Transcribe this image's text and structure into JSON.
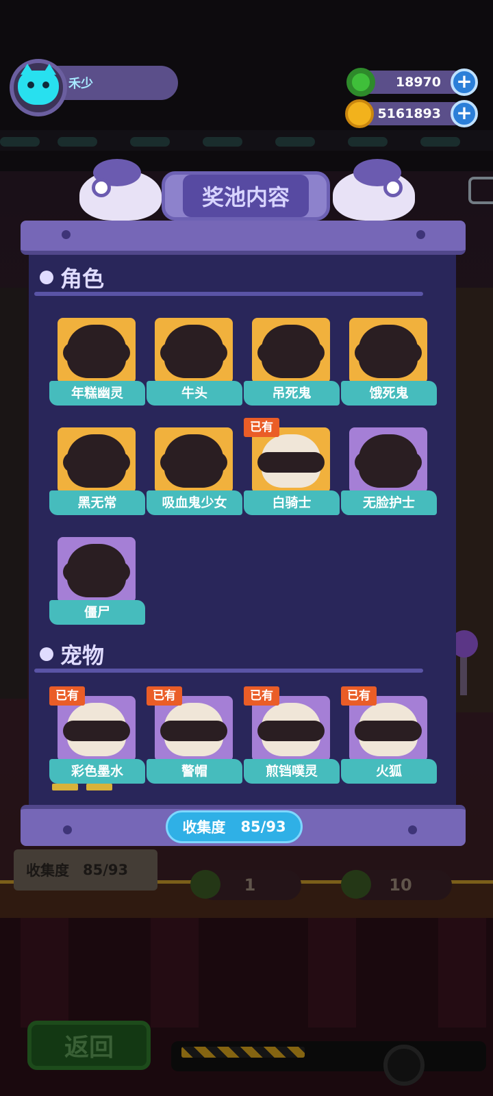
{
  "player": {
    "name": "禾少"
  },
  "currencies": [
    {
      "icon": "green-donut-icon",
      "value": "18970"
    },
    {
      "icon": "gold-planet-coin-icon",
      "value": "5161893"
    }
  ],
  "modal": {
    "title": "奖池内容",
    "sections": {
      "characters": {
        "title": "角色",
        "items": [
          {
            "name": "年糕幽灵",
            "owned": false,
            "rarity": "gold"
          },
          {
            "name": "牛头",
            "owned": false,
            "rarity": "gold"
          },
          {
            "name": "吊死鬼",
            "owned": false,
            "rarity": "gold"
          },
          {
            "name": "饿死鬼",
            "owned": false,
            "rarity": "gold"
          },
          {
            "name": "黑无常",
            "owned": false,
            "rarity": "gold"
          },
          {
            "name": "吸血鬼少女",
            "owned": false,
            "rarity": "gold"
          },
          {
            "name": "白骑士",
            "owned": true,
            "rarity": "gold"
          },
          {
            "name": "无脸护士",
            "owned": false,
            "rarity": "purple"
          },
          {
            "name": "僵尸",
            "owned": false,
            "rarity": "purple"
          }
        ]
      },
      "pets": {
        "title": "宠物",
        "items": [
          {
            "name": "彩色墨水",
            "owned": true,
            "rarity": "purple"
          },
          {
            "name": "警帽",
            "owned": true,
            "rarity": "purple"
          },
          {
            "name": "煎铛噗灵",
            "owned": true,
            "rarity": "purple"
          },
          {
            "name": "火狐",
            "owned": true,
            "rarity": "purple"
          }
        ]
      }
    },
    "owned_badge": "已有",
    "collection": {
      "label": "收集度",
      "value": "85/93"
    }
  },
  "background": {
    "collection_label": "收集度",
    "collection_value": "85/93",
    "price_single": "1",
    "price_multi": "10",
    "back_button": "返回"
  },
  "colors": {
    "gold_card": "#f1b13d",
    "purple_card": "#a57fd6",
    "label_teal": "#46bcbd",
    "owned_badge": "#ea5d27",
    "panel": "#29265a",
    "pill_blue": "#2fb0e6"
  }
}
